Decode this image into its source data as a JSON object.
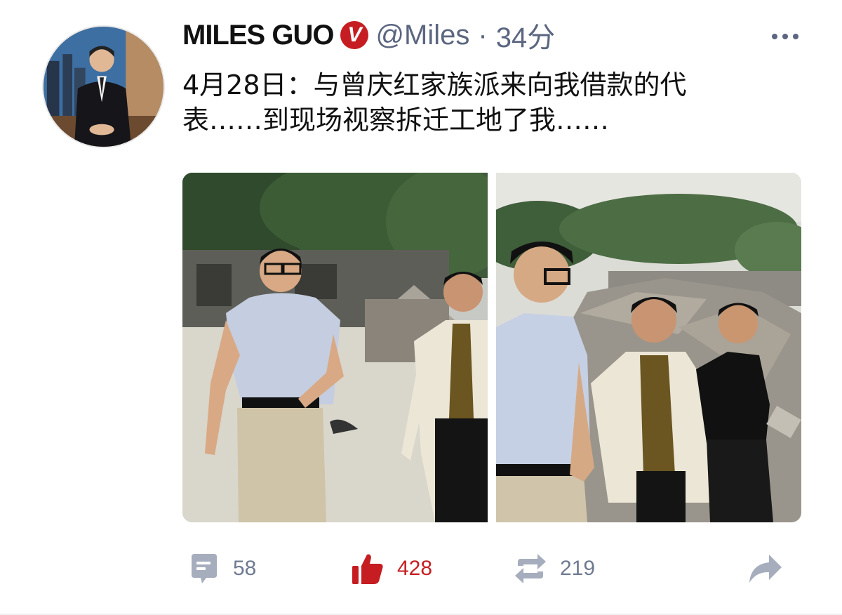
{
  "post": {
    "username": "MILES GUO",
    "verified_glyph": "V",
    "handle": "@Miles",
    "separator": "·",
    "time": "34分",
    "text_lines": [
      "4月28日：与曾庆红家族派来向我借款的代",
      "表……到现场视察拆迁工地了我……"
    ]
  },
  "actions": {
    "comments": "58",
    "likes": "428",
    "reposts": "219"
  },
  "colors": {
    "accent_red": "#c51d22",
    "meta_gray": "#5b6680",
    "icon_gray": "#6f7a91"
  },
  "icons": {
    "more": "more-dots-icon",
    "comment": "comment-icon",
    "like": "thumbs-up-icon",
    "repost": "repost-icon",
    "share": "share-arrow-icon",
    "verified": "verified-badge-icon"
  }
}
